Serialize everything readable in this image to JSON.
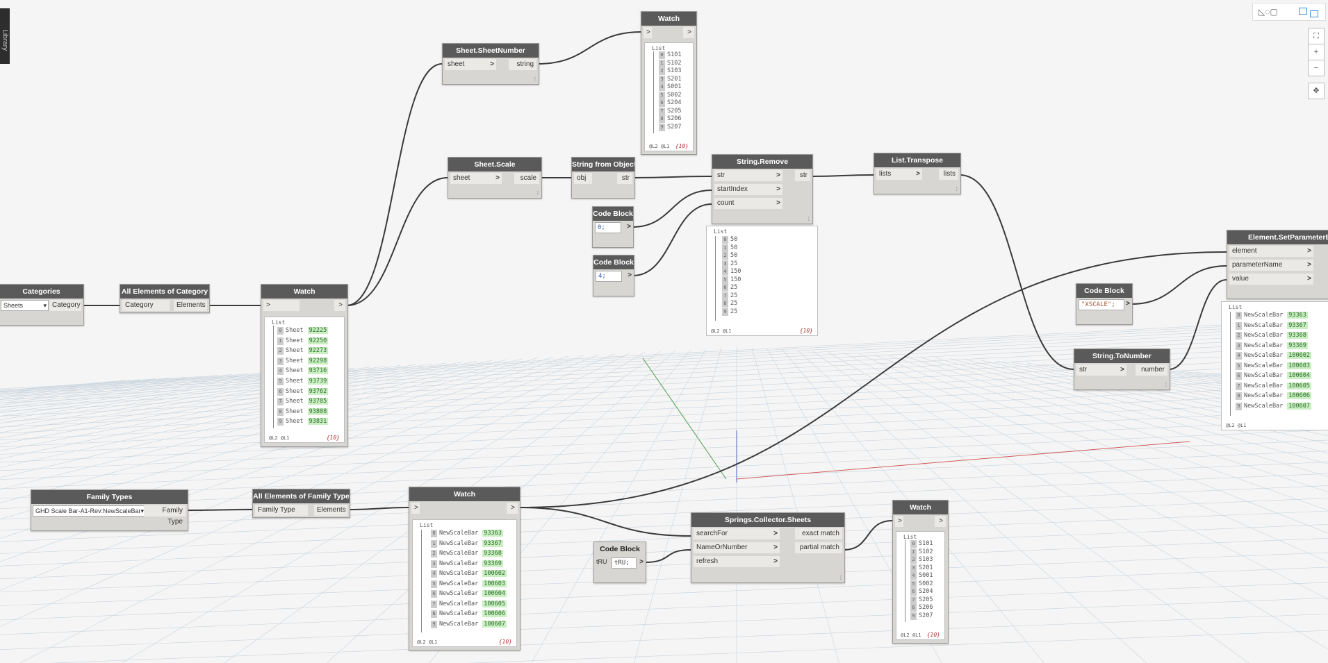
{
  "colors": {
    "wire": "#3a3a3a",
    "header": "#5a5a5a",
    "node_body": "#d8d6d2",
    "grid": "#c8d3dc",
    "green_val": "#c9efc2"
  },
  "library_tab": {
    "label": "Library"
  },
  "toolbar": {
    "view_icon": "3d-view-icon",
    "graph_icon": "graph-view-icon",
    "fit_icon": "zoom-fit-icon",
    "zoom_in": "+",
    "zoom_out": "−",
    "pan_icon": "pan-icon"
  },
  "nodes": {
    "categories": {
      "title": "Categories",
      "dropdown": "Sheets",
      "out": "Category"
    },
    "all_elements_category": {
      "title": "All Elements of Category",
      "in": "Category",
      "out": "Elements"
    },
    "watch_sheets": {
      "title": "Watch",
      "in": ">",
      "out": ">",
      "list_label": "List",
      "foot": "@L2 @L1",
      "count": "{10}",
      "items": [
        {
          "i": "0",
          "name": "Sheet",
          "v": "92225"
        },
        {
          "i": "1",
          "name": "Sheet",
          "v": "92250"
        },
        {
          "i": "2",
          "name": "Sheet",
          "v": "92273"
        },
        {
          "i": "3",
          "name": "Sheet",
          "v": "92298"
        },
        {
          "i": "4",
          "name": "Sheet",
          "v": "93716"
        },
        {
          "i": "5",
          "name": "Sheet",
          "v": "93739"
        },
        {
          "i": "6",
          "name": "Sheet",
          "v": "93762"
        },
        {
          "i": "7",
          "name": "Sheet",
          "v": "93785"
        },
        {
          "i": "8",
          "name": "Sheet",
          "v": "93808"
        },
        {
          "i": "9",
          "name": "Sheet",
          "v": "93831"
        }
      ]
    },
    "sheet_number": {
      "title": "Sheet.SheetNumber",
      "in": "sheet",
      "out": "string"
    },
    "watch_numbers": {
      "title": "Watch",
      "in": ">",
      "out": ">",
      "list_label": "List",
      "foot": "@L2 @L1",
      "count": "{10}",
      "items": [
        "S101",
        "S102",
        "S103",
        "S201",
        "S001",
        "S002",
        "S204",
        "S205",
        "S206",
        "S207"
      ]
    },
    "sheet_scale": {
      "title": "Sheet.Scale",
      "in": "sheet",
      "out": "scale"
    },
    "string_from_object": {
      "title": "String from Object",
      "in": "obj",
      "out": "str"
    },
    "code_block_0": {
      "title": "Code Block",
      "code": "0;",
      "out": ">"
    },
    "code_block_4": {
      "title": "Code Block",
      "code": "4;",
      "out": ">"
    },
    "string_remove": {
      "title": "String.Remove",
      "in1": "str",
      "in2": "startIndex",
      "in3": "count",
      "out": "str"
    },
    "watch_remove": {
      "list_label": "List",
      "foot": "@L2 @L1",
      "count": "{10}",
      "items": [
        "50",
        "50",
        "50",
        "25",
        "150",
        "150",
        "25",
        "25",
        "25",
        "25"
      ]
    },
    "list_transpose": {
      "title": "List.Transpose",
      "in": "lists",
      "out": "lists"
    },
    "set_param": {
      "title": "Element.SetParameterByName",
      "in1": "element",
      "in2": "parameterName",
      "in3": "value"
    },
    "code_block_xscale": {
      "title": "Code Block",
      "code": "\"XSCALE\";",
      "out": ">"
    },
    "string_to_number": {
      "title": "String.ToNumber",
      "in": "str",
      "out": "number"
    },
    "watch_set": {
      "list_label": "List",
      "foot": "@L2 @L1",
      "items": [
        {
          "i": "0",
          "name": "NewScaleBar",
          "v": "93363"
        },
        {
          "i": "1",
          "name": "NewScaleBar",
          "v": "93367"
        },
        {
          "i": "2",
          "name": "NewScaleBar",
          "v": "93368"
        },
        {
          "i": "3",
          "name": "NewScaleBar",
          "v": "93369"
        },
        {
          "i": "4",
          "name": "NewScaleBar",
          "v": "100602"
        },
        {
          "i": "5",
          "name": "NewScaleBar",
          "v": "100603"
        },
        {
          "i": "6",
          "name": "NewScaleBar",
          "v": "100604"
        },
        {
          "i": "7",
          "name": "NewScaleBar",
          "v": "100605"
        },
        {
          "i": "8",
          "name": "NewScaleBar",
          "v": "100606"
        },
        {
          "i": "9",
          "name": "NewScaleBar",
          "v": "100607"
        }
      ]
    },
    "family_types": {
      "title": "Family Types",
      "dropdown": "GHD Scale Bar-A1-Rev:NewScaleBar",
      "out": "Family Type"
    },
    "all_elements_family": {
      "title": "All Elements of Family Type",
      "in": "Family Type",
      "out": "Elements"
    },
    "watch_scalebars": {
      "title": "Watch",
      "in": ">",
      "out": ">",
      "list_label": "List",
      "foot": "@L2 @L1",
      "count": "{10}",
      "items": [
        {
          "i": "0",
          "name": "NewScaleBar",
          "v": "93363"
        },
        {
          "i": "1",
          "name": "NewScaleBar",
          "v": "93367"
        },
        {
          "i": "2",
          "name": "NewScaleBar",
          "v": "93368"
        },
        {
          "i": "3",
          "name": "NewScaleBar",
          "v": "93369"
        },
        {
          "i": "4",
          "name": "NewScaleBar",
          "v": "100602"
        },
        {
          "i": "5",
          "name": "NewScaleBar",
          "v": "100603"
        },
        {
          "i": "6",
          "name": "NewScaleBar",
          "v": "100604"
        },
        {
          "i": "7",
          "name": "NewScaleBar",
          "v": "100605"
        },
        {
          "i": "8",
          "name": "NewScaleBar",
          "v": "100606"
        },
        {
          "i": "9",
          "name": "NewScaleBar",
          "v": "100607"
        }
      ]
    },
    "code_block_true": {
      "title": "Code Block",
      "preview": "tRU",
      "code": "tRU;",
      "out": ">"
    },
    "springs_collector": {
      "title": "Springs.Collector.Sheets",
      "in1": "searchFor",
      "in2": "NameOrNumber",
      "in3": "refresh",
      "out1": "exact match",
      "out2": "partial match"
    },
    "watch_springs": {
      "title": "Watch",
      "in": ">",
      "out": ">",
      "list_label": "List",
      "foot": "@L2 @L1",
      "count": "{10}",
      "items": [
        "S101",
        "S102",
        "S103",
        "S201",
        "S001",
        "S002",
        "S204",
        "S205",
        "S206",
        "S207"
      ]
    }
  }
}
